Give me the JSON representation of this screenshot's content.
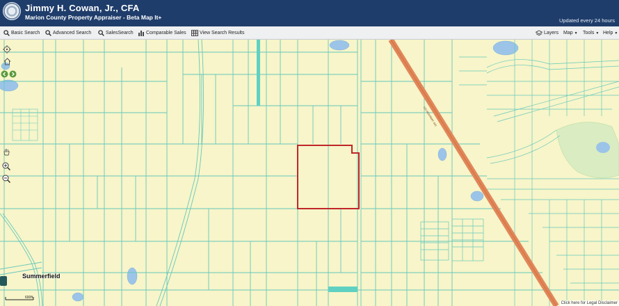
{
  "header": {
    "title": "Jimmy H. Cowan, Jr., CFA",
    "subtitle": "Marion County Property Appraiser - Beta Map It+",
    "updated": "Updated every 24 hours"
  },
  "toolbar": {
    "basic_search": "Basic Search",
    "advanced_search": "Advanced Search",
    "sales_search": "SalesSearch",
    "comparable_sales": "Comparable Sales",
    "view_results": "View Search Results",
    "layers": "Layers",
    "map": "Map",
    "tools": "Tools",
    "help": "Help"
  },
  "map": {
    "town_label": "Summerfield",
    "scale_label": "600ft",
    "legal": "Click here for Legal Disclaimer",
    "highway_label": "US HIGHWAY 441",
    "colors": {
      "background": "#f7f5c9",
      "parcel_line": "#66c8bb",
      "highway": "#e0875a",
      "selection": "#c0262b"
    }
  }
}
